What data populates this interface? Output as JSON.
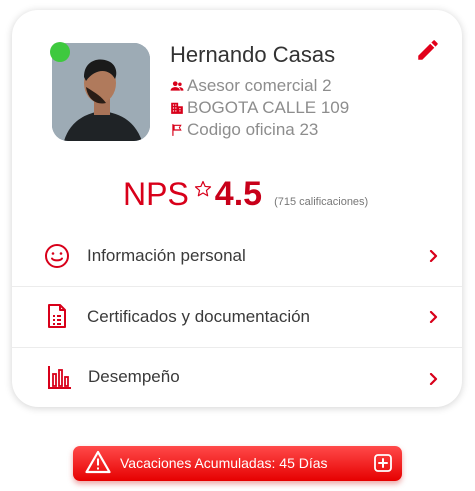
{
  "profile": {
    "name": "Hernando Casas",
    "role": "Asesor comercial 2",
    "office": "BOGOTA CALLE 109",
    "office_code": "Codigo oficina 23",
    "status": "online"
  },
  "nps": {
    "label": "NPS",
    "value": "4.5",
    "count": "(715 calificaciones)"
  },
  "menu": [
    {
      "label": "Información personal",
      "icon": "smile-icon"
    },
    {
      "label": "Certificados y documentación",
      "icon": "document-icon"
    },
    {
      "label": "Desempeño",
      "icon": "bar-chart-icon"
    }
  ],
  "vacations": {
    "label": "Vacaciones Acumuladas: 45 Días"
  },
  "colors": {
    "accent": "#d8001a",
    "online": "#3ec93e",
    "muted": "#8d8d8d"
  }
}
